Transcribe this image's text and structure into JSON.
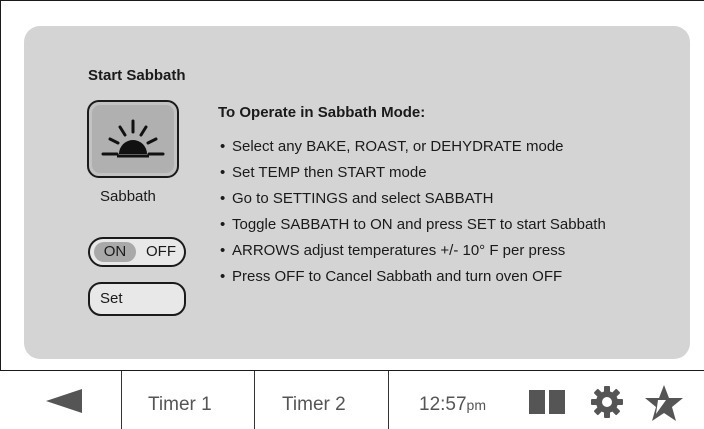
{
  "sabbath_panel": {
    "title": "Start Sabbath",
    "button_label": "Sabbath",
    "toggle": {
      "on_label": "ON",
      "off_label": "OFF",
      "selected": "ON"
    },
    "set_label": "Set"
  },
  "instructions": {
    "title": "To Operate in Sabbath Mode:",
    "items": [
      "Select any BAKE, ROAST, or DEHYDRATE mode",
      "Set TEMP then START mode",
      "Go to SETTINGS and select SABBATH",
      "Toggle SABBATH to ON and press SET to start Sabbath",
      "ARROWS adjust temperatures +/- 10° F per press",
      "Press OFF to Cancel Sabbath and turn oven OFF"
    ]
  },
  "bottom_bar": {
    "back_icon": "back-arrow-icon",
    "timer1": "Timer 1",
    "timer2": "Timer 2",
    "clock_time": "12:57",
    "clock_ampm": "pm",
    "icons": [
      "split-view-icon",
      "gear-icon",
      "star-icon"
    ]
  },
  "colors": {
    "panel_bg": "#d4d4d4",
    "nav_gray": "#555555",
    "toggle_selected": "#a9a9a9"
  }
}
